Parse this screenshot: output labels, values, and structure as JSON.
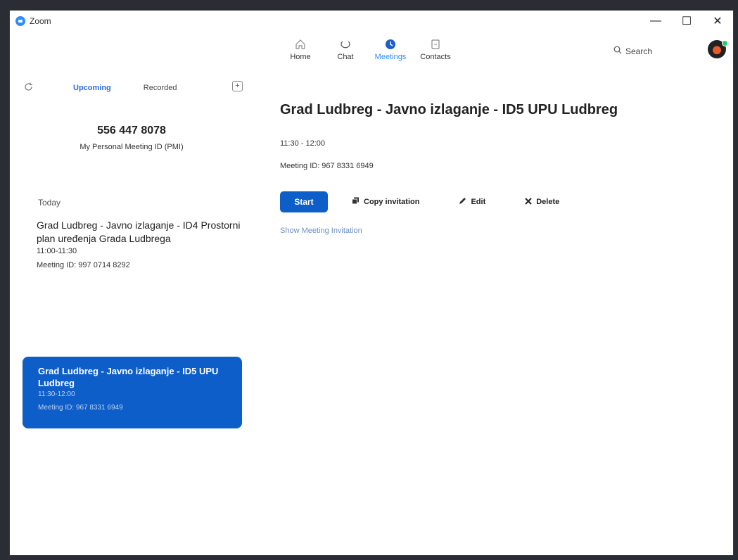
{
  "window": {
    "app_name": "Zoom",
    "controls": {
      "minimize": "—",
      "maximize": "☐",
      "close": "✕"
    }
  },
  "nav": {
    "tabs": [
      {
        "label": "Home",
        "icon": "home-icon"
      },
      {
        "label": "Chat",
        "icon": "chat-icon"
      },
      {
        "label": "Meetings",
        "icon": "clock-icon",
        "active": true
      },
      {
        "label": "Contacts",
        "icon": "contact-card-icon"
      }
    ],
    "search_label": "Search"
  },
  "left": {
    "tabs": {
      "upcoming": "Upcoming",
      "recorded": "Recorded"
    },
    "add_symbol": "+",
    "pmi_number": "556 447 8078",
    "pmi_label": "My Personal Meeting ID (PMI)",
    "section_today": "Today",
    "meetings": [
      {
        "title": "Grad Ludbreg - Javno izlaganje - ID4 Prostorni plan uređenja Grada Ludbrega",
        "time": "11:00-11:30",
        "meeting_id": "Meeting ID: 997 0714 8292"
      },
      {
        "title": "Grad Ludbreg - Javno izlaganje - ID5 UPU Ludbreg",
        "time": "11:30-12:00",
        "meeting_id": "Meeting ID: 967 8331 6949",
        "selected": true
      }
    ]
  },
  "detail": {
    "title": "Grad Ludbreg - Javno izlaganje - ID5 UPU Ludbreg",
    "time": "11:30 - 12:00",
    "meeting_id": "Meeting ID: 967 8331 6949",
    "start": "Start",
    "copy_invitation": "Copy invitation",
    "edit": "Edit",
    "delete": "Delete",
    "show_invitation": "Show Meeting Invitation"
  },
  "colors": {
    "accent": "#2d8cff",
    "selected_bg": "#0e5ec9",
    "link": "#6f8fc6"
  }
}
